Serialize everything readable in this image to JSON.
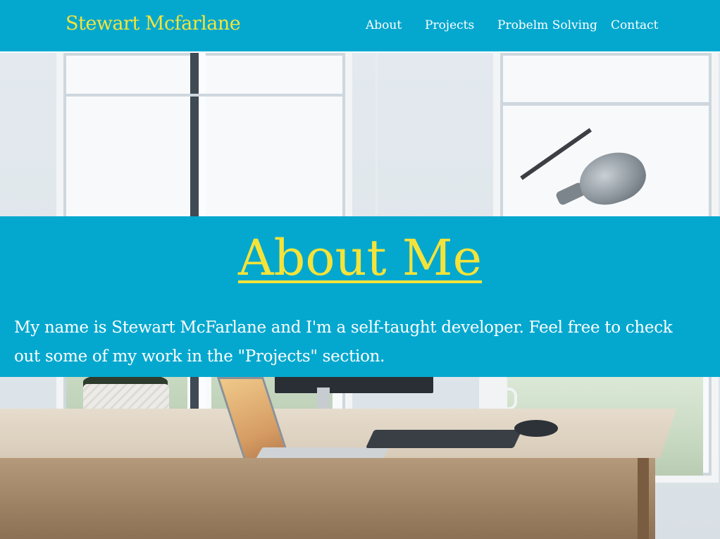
{
  "navbar": {
    "brand": "Stewart Mcfarlane",
    "links": [
      "About",
      "Projects",
      "Probelm Solving",
      "Contact"
    ]
  },
  "about": {
    "title": "About Me",
    "text": "My name is Stewart McFarlane and I'm a self-taught developer. Feel free to check out some of my work in the \"Projects\" section."
  },
  "colors": {
    "primary": "#04a8cf",
    "accent": "#f5e33a",
    "text_light": "#ffffff"
  }
}
